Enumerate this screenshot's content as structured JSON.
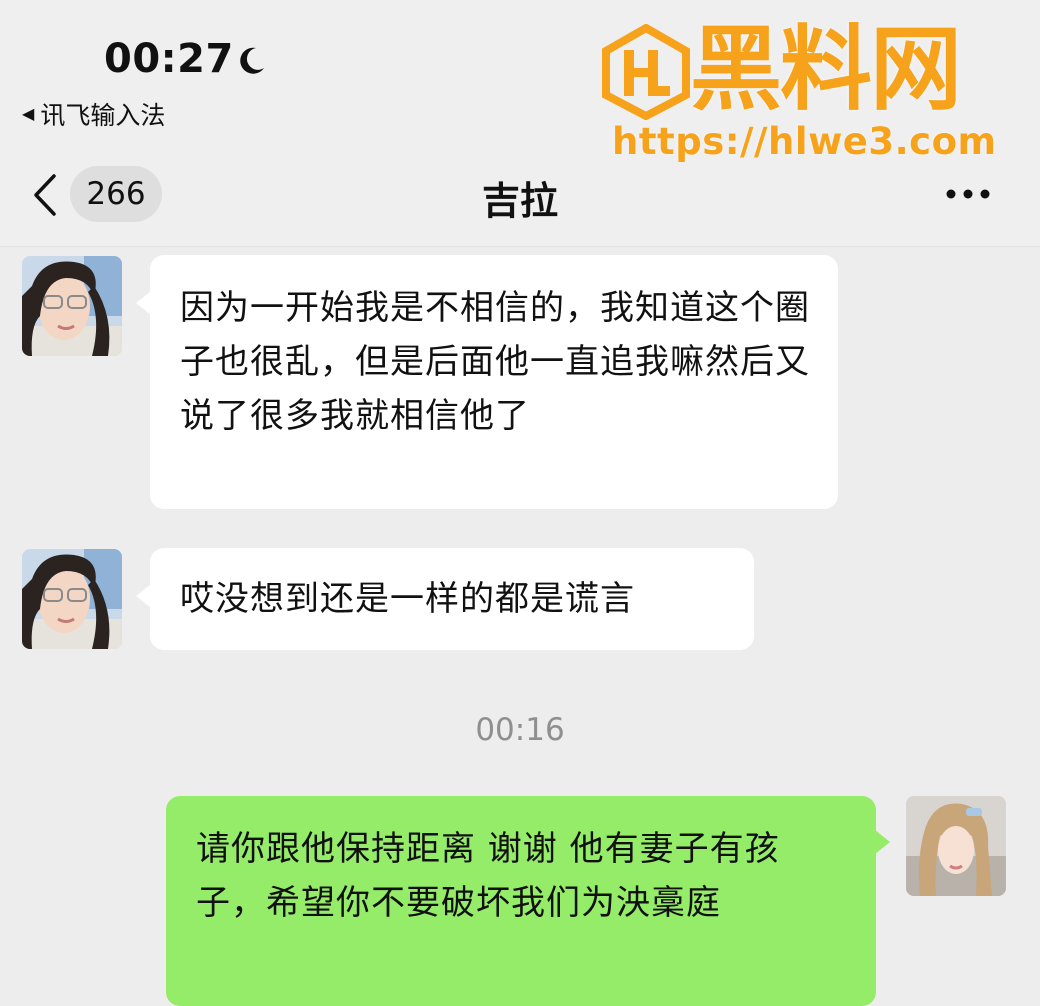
{
  "status_bar": {
    "time": "00:27",
    "back_app": "讯飞输入法"
  },
  "nav": {
    "unread_count": "266",
    "title": "吉拉"
  },
  "watermark": {
    "brand": "黑料网",
    "url": "https://hlwe3.com"
  },
  "messages": [
    {
      "side": "left",
      "text": "因为一开始我是不相信的，我知道这个圈子也很乱，但是后面他一直追我嘛然后又说了很多我就相信他了"
    },
    {
      "side": "left",
      "text": "哎没想到还是一样的都是谎言"
    },
    {
      "side": "right",
      "text": "请你跟他保持距离 谢谢 他有妻子有孩子，希望你不要破坏我们为泱稾庭"
    }
  ],
  "timestamp": "00:16",
  "colors": {
    "background": "#ededed",
    "incoming_bubble": "#ffffff",
    "outgoing_bubble": "#95ec69",
    "watermark": "#f7a21b"
  }
}
